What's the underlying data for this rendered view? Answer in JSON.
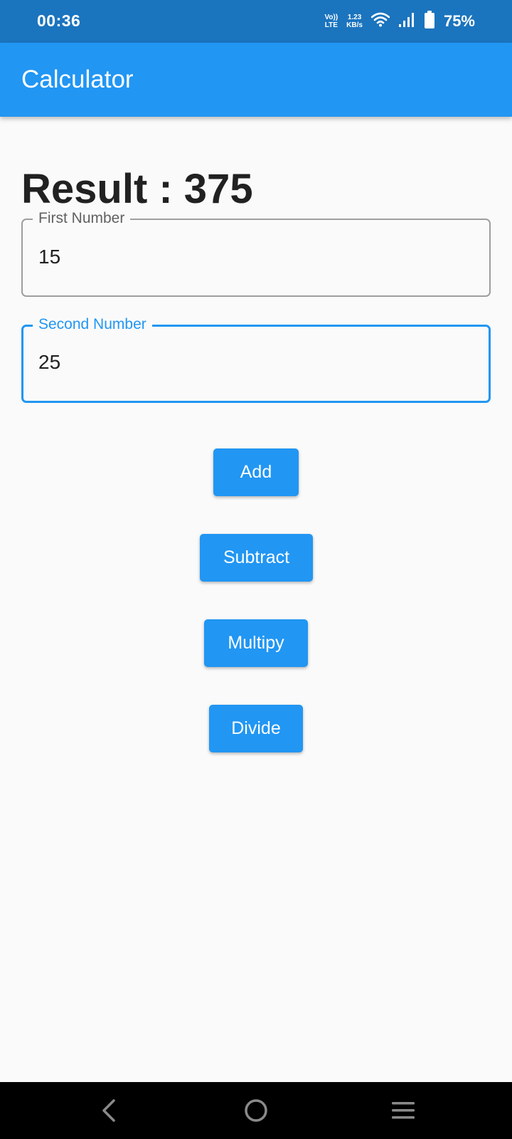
{
  "status_bar": {
    "time": "00:36",
    "volte_top": "Vo))",
    "volte_bottom": "LTE",
    "speed_value": "1.23",
    "speed_unit": "KB/s",
    "battery_percent": "75%"
  },
  "app_bar": {
    "title": "Calculator"
  },
  "result": {
    "text": "Result : 375"
  },
  "first_number": {
    "label": "First Number",
    "value": "15"
  },
  "second_number": {
    "label": "Second Number",
    "value": "25"
  },
  "buttons": {
    "add": "Add",
    "subtract": "Subtract",
    "multiply": "Multipy",
    "divide": "Divide"
  },
  "colors": {
    "status_bar": "#1B74BE",
    "app_bar": "#2196F3",
    "accent": "#2196F3",
    "background": "#FAFAFA"
  },
  "icons": {
    "wifi": "wifi-icon",
    "signal": "signal-icon",
    "battery": "battery-icon",
    "back": "back-icon",
    "home": "home-icon",
    "menu": "menu-icon"
  }
}
